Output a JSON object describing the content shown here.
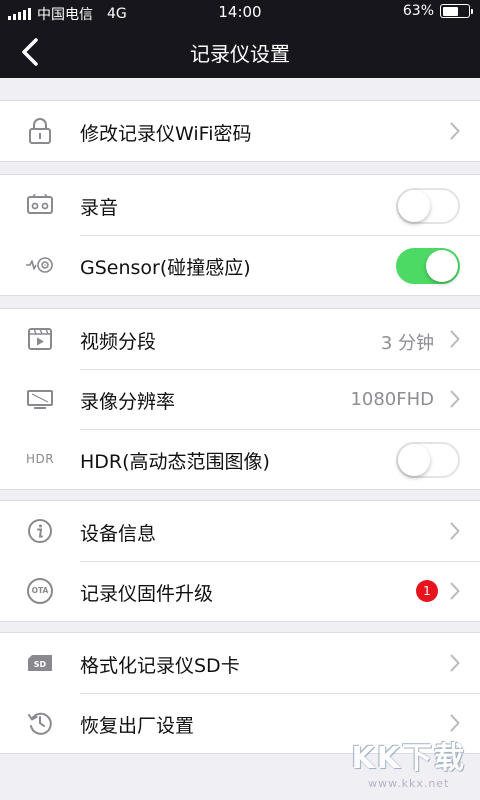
{
  "status_bar": {
    "carrier": "中国电信",
    "network": "4G",
    "time": "14:00",
    "battery": "63%",
    "battery_level": 0.63
  },
  "nav": {
    "title": "记录仪设置",
    "back_icon": "chevron-left-icon"
  },
  "groups": {
    "wifi": {
      "password": {
        "label": "修改记录仪WiFi密码",
        "icon": "lock-icon"
      }
    },
    "sensors": {
      "audio": {
        "label": "录音",
        "icon": "recorder-icon",
        "enabled": false
      },
      "gsensor": {
        "label": "GSensor(碰撞感应)",
        "icon": "vibration-icon",
        "enabled": true
      }
    },
    "video": {
      "segment": {
        "label": "视频分段",
        "icon": "video-clip-icon",
        "value": "3 分钟"
      },
      "resolution": {
        "label": "录像分辨率",
        "icon": "monitor-icon",
        "value": "1080FHD"
      },
      "hdr": {
        "label": "HDR(高动态范围图像)",
        "icon_text": "HDR",
        "enabled": false
      }
    },
    "device": {
      "info": {
        "label": "设备信息",
        "icon": "info-icon"
      },
      "firmware": {
        "label": "记录仪固件升级",
        "icon_text": "OTA",
        "badge": "1"
      }
    },
    "storage": {
      "format": {
        "label": "格式化记录仪SD卡",
        "icon": "sd-card-icon"
      },
      "reset": {
        "label": "恢复出厂设置",
        "icon": "history-icon"
      }
    }
  },
  "watermark": {
    "logo": "KK下载",
    "url": "www.kkx.net"
  },
  "colors": {
    "nav_bg": "#16161c",
    "page_bg": "#efeff4",
    "toggle_on": "#4cd964",
    "badge": "#e8141d"
  }
}
